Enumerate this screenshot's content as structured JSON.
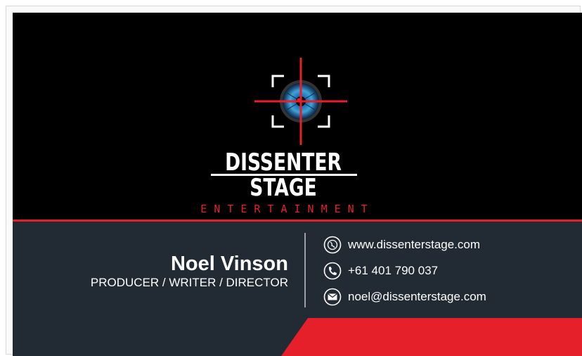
{
  "brand": {
    "name": "DISSENTER STAGE",
    "subtitle": "ENTERTAINMENT"
  },
  "person": {
    "name": "Noel Vinson",
    "role": "PRODUCER / WRITER / DIRECTOR"
  },
  "contacts": [
    {
      "icon": "globe-icon",
      "text": "www.dissenterstage.com"
    },
    {
      "icon": "phone-icon",
      "text": "+61 401 790 037"
    },
    {
      "icon": "envelope-icon",
      "text": "noel@dissenterstage.com"
    }
  ],
  "colors": {
    "accent": "#e5202b",
    "dark": "#222a33",
    "black": "#000000",
    "white": "#ffffff"
  }
}
